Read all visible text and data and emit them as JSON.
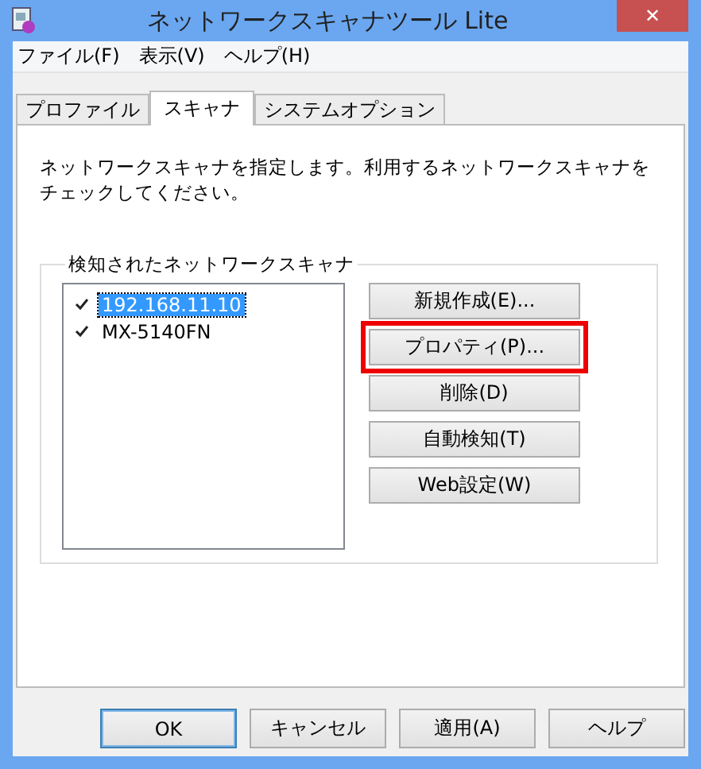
{
  "window": {
    "title": "ネットワークスキャナツール Lite",
    "close": "✕"
  },
  "menu": [
    "ファイル(F)",
    "表示(V)",
    "ヘルプ(H)"
  ],
  "tabs": [
    {
      "label": "プロファイル",
      "selected": false
    },
    {
      "label": "スキャナ",
      "selected": true
    },
    {
      "label": "システムオプション",
      "selected": false
    }
  ],
  "description": "ネットワークスキャナを指定します。利用するネットワークスキャナをチェックしてください。",
  "group": {
    "title": "検知されたネットワークスキャナ",
    "scanners": [
      {
        "name": "192.168.11.10",
        "checked": true,
        "selected": true
      },
      {
        "name": "MX-5140FN",
        "checked": true,
        "selected": false
      }
    ],
    "buttons": [
      {
        "label": "新規作成(E)...",
        "highlighted": false
      },
      {
        "label": "プロパティ(P)...",
        "highlighted": true
      },
      {
        "label": "削除(D)",
        "highlighted": false
      },
      {
        "label": "自動検知(T)",
        "highlighted": false
      },
      {
        "label": "Web設定(W)",
        "highlighted": false
      }
    ]
  },
  "footer": [
    {
      "label": "OK",
      "default": true
    },
    {
      "label": "キャンセル",
      "default": false
    },
    {
      "label": "適用(A)",
      "default": false
    },
    {
      "label": "ヘルプ",
      "default": false
    }
  ]
}
